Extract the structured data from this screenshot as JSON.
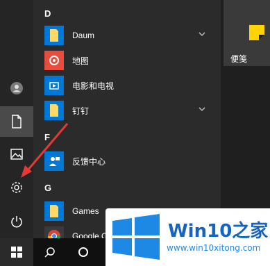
{
  "start_menu": {
    "section_d": "D",
    "section_f": "F",
    "section_g": "G",
    "items": {
      "daum": "Daum",
      "map": "地图",
      "movies": "电影和电视",
      "dingtalk": "钉钉",
      "feedback": "反馈中心",
      "games": "Games",
      "chrome": "Google Chrome"
    }
  },
  "tiles": {
    "sticky_notes": "便笺"
  },
  "watermark": {
    "title": "Win10之家",
    "url": "www.win10xitong.com"
  },
  "colors": {
    "folder": "#ffd966",
    "accent_blue": "#0078d7",
    "map_red": "#e74c3c",
    "arrow_red": "#e53935",
    "sticky_yellow": "#ffd400"
  }
}
